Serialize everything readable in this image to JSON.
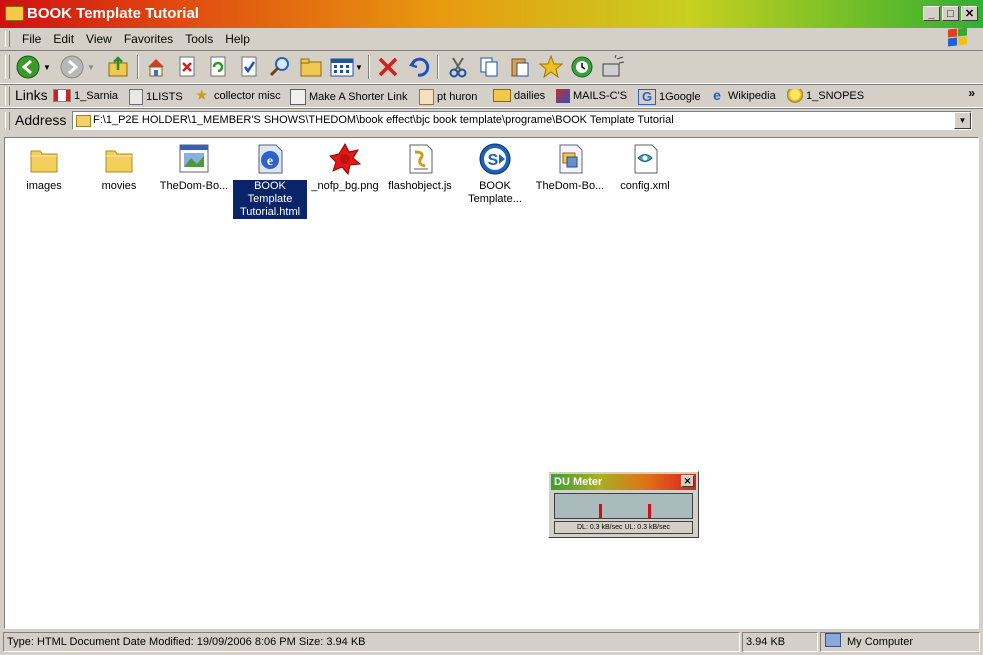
{
  "window": {
    "title": "BOOK Template Tutorial"
  },
  "menu": [
    "File",
    "Edit",
    "View",
    "Favorites",
    "Tools",
    "Help"
  ],
  "links_label": "Links",
  "links": [
    {
      "label": "1_Sarnia",
      "icon": "flag-icon"
    },
    {
      "label": "1LISTS",
      "icon": "list-icon"
    },
    {
      "label": "collector misc",
      "icon": "star-icon"
    },
    {
      "label": "Make A Shorter Link",
      "icon": "link-icon"
    },
    {
      "label": "pt huron",
      "icon": "page-icon"
    },
    {
      "label": "dailies",
      "icon": "folder-icon"
    },
    {
      "label": "MAILS-C'S",
      "icon": "mail-icon"
    },
    {
      "label": "1Google",
      "icon": "google-icon"
    },
    {
      "label": "Wikipedia",
      "icon": "ie-icon"
    },
    {
      "label": "1_SNOPES",
      "icon": "bulb-icon"
    }
  ],
  "address": {
    "label": "Address",
    "path": "F:\\1_P2E HOLDER\\1_MEMBER'S SHOWS\\THEDOM\\book effect\\bjc book template\\programe\\BOOK Template Tutorial"
  },
  "files": [
    {
      "name": "images",
      "icon": "folder-icon",
      "selected": false
    },
    {
      "name": "movies",
      "icon": "folder-icon",
      "selected": false
    },
    {
      "name": "TheDom-Bo...",
      "icon": "image-file-icon",
      "selected": false
    },
    {
      "name": "BOOK Template Tutorial.html",
      "icon": "ie-html-icon",
      "selected": true
    },
    {
      "name": "_nofp_bg.png",
      "icon": "png-file-icon",
      "selected": false
    },
    {
      "name": "flashobject.js",
      "icon": "script-file-icon",
      "selected": false
    },
    {
      "name": "BOOK Template...",
      "icon": "shockwave-icon",
      "selected": false
    },
    {
      "name": "TheDom-Bo...",
      "icon": "document-file-icon",
      "selected": false
    },
    {
      "name": "config.xml",
      "icon": "xml-file-icon",
      "selected": false
    }
  ],
  "du_meter": {
    "title": "DU Meter",
    "stats": "DL: 0.3 kB/sec  UL: 0.3 kB/sec"
  },
  "status": {
    "info": "Type: HTML Document Date Modified: 19/09/2006 8:06 PM Size: 3.94 KB",
    "size": "3.94 KB",
    "zone": "My Computer"
  }
}
